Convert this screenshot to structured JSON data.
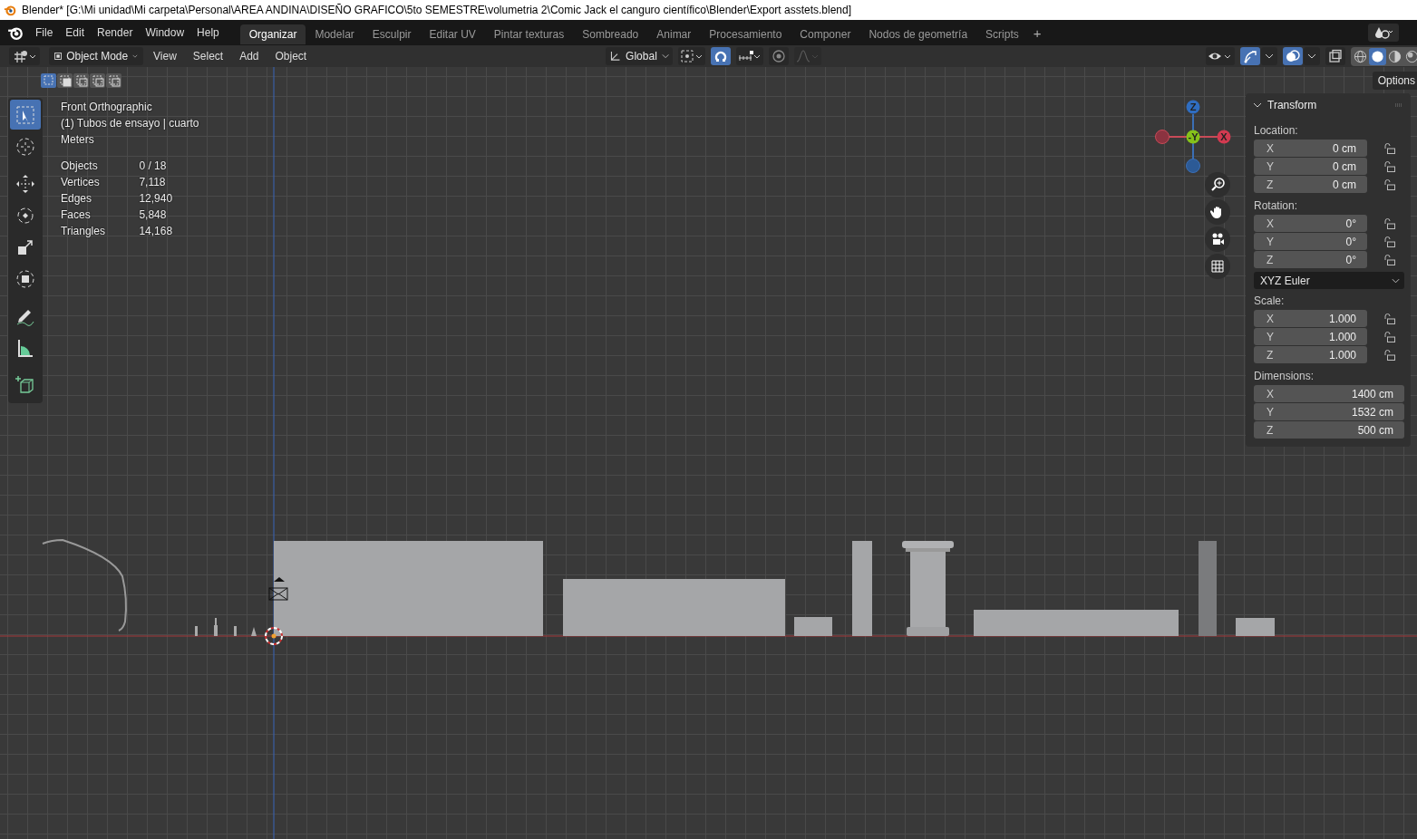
{
  "window": {
    "title": "Blender* [G:\\Mi unidad\\Mi carpeta\\Personal\\AREA ANDINA\\DISEÑO GRAFICO\\5to SEMESTRE\\volumetria 2\\Comic Jack el canguro científico\\Blender\\Export asstets.blend]"
  },
  "menu": [
    "File",
    "Edit",
    "Render",
    "Window",
    "Help"
  ],
  "workspaces": [
    {
      "label": "Organizar",
      "selected": true
    },
    {
      "label": "Modelar",
      "selected": false
    },
    {
      "label": "Esculpir",
      "selected": false
    },
    {
      "label": "Editar UV",
      "selected": false
    },
    {
      "label": "Pintar texturas",
      "selected": false
    },
    {
      "label": "Sombreado",
      "selected": false
    },
    {
      "label": "Animar",
      "selected": false
    },
    {
      "label": "Procesamiento",
      "selected": false
    },
    {
      "label": "Componer",
      "selected": false
    },
    {
      "label": "Nodos de geometría",
      "selected": false
    },
    {
      "label": "Scripts",
      "selected": false
    }
  ],
  "add_workspace": "+",
  "header": {
    "mode": "Object Mode",
    "menus": [
      "View",
      "Select",
      "Add",
      "Object"
    ],
    "orientation": "Global",
    "toggles": [
      {
        "kind": "snap",
        "on": true
      },
      {
        "kind": "proportional",
        "on": false
      },
      {
        "kind": "gizmo",
        "on": true
      },
      {
        "kind": "overlay",
        "on": true
      },
      {
        "kind": "xray",
        "on": false
      }
    ],
    "shading": [
      {
        "kind": "wireframe",
        "selected": false
      },
      {
        "kind": "solid",
        "selected": true
      },
      {
        "kind": "material",
        "selected": false
      },
      {
        "kind": "rendered",
        "selected": false
      }
    ]
  },
  "select_modes": [
    {
      "kind": "new",
      "selected": true
    },
    {
      "kind": "extend",
      "selected": false
    },
    {
      "kind": "subtract",
      "selected": false
    },
    {
      "kind": "difference",
      "selected": false
    },
    {
      "kind": "intersect",
      "selected": false
    }
  ],
  "options_button": "Options",
  "tools": [
    {
      "kind": "select",
      "selected": true
    },
    {
      "kind": "cursor",
      "selected": false
    },
    {
      "kind": "move",
      "selected": false
    },
    {
      "kind": "rotate",
      "selected": false
    },
    {
      "kind": "scale",
      "selected": false
    },
    {
      "kind": "transform",
      "selected": false
    },
    {
      "kind": "annotate",
      "selected": false
    },
    {
      "kind": "measure",
      "selected": false
    },
    {
      "kind": "add-cube",
      "selected": false
    }
  ],
  "viewport_info": {
    "view": "Front Orthographic",
    "collection": "(1) Tubos de ensayo | cuarto",
    "units": "Meters",
    "stats": [
      {
        "label": "Objects",
        "value": "0 / 18"
      },
      {
        "label": "Vertices",
        "value": "7,118"
      },
      {
        "label": "Edges",
        "value": "12,940"
      },
      {
        "label": "Faces",
        "value": "5,848"
      },
      {
        "label": "Triangles",
        "value": "14,168"
      }
    ]
  },
  "gizmo": {
    "z": "Z",
    "y": "-Y",
    "x": "X"
  },
  "transform": {
    "title": "Transform",
    "sections": [
      {
        "label": "Location:",
        "rows": [
          {
            "axis": "X",
            "value": "0 cm",
            "locked": false
          },
          {
            "axis": "Y",
            "value": "0 cm",
            "locked": false
          },
          {
            "axis": "Z",
            "value": "0 cm",
            "locked": false
          }
        ]
      },
      {
        "label": "Rotation:",
        "rows": [
          {
            "axis": "X",
            "value": "0°",
            "locked": false
          },
          {
            "axis": "Y",
            "value": "0°",
            "locked": false
          },
          {
            "axis": "Z",
            "value": "0°",
            "locked": false
          }
        ],
        "mode": "XYZ Euler"
      },
      {
        "label": "Scale:",
        "rows": [
          {
            "axis": "X",
            "value": "1.000",
            "locked": false
          },
          {
            "axis": "Y",
            "value": "1.000",
            "locked": false
          },
          {
            "axis": "Z",
            "value": "1.000",
            "locked": false
          }
        ]
      },
      {
        "label": "Dimensions:",
        "rows": [
          {
            "axis": "X",
            "value": "1400 cm"
          },
          {
            "axis": "Y",
            "value": "1532 cm"
          },
          {
            "axis": "Z",
            "value": "500 cm"
          }
        ]
      }
    ]
  }
}
